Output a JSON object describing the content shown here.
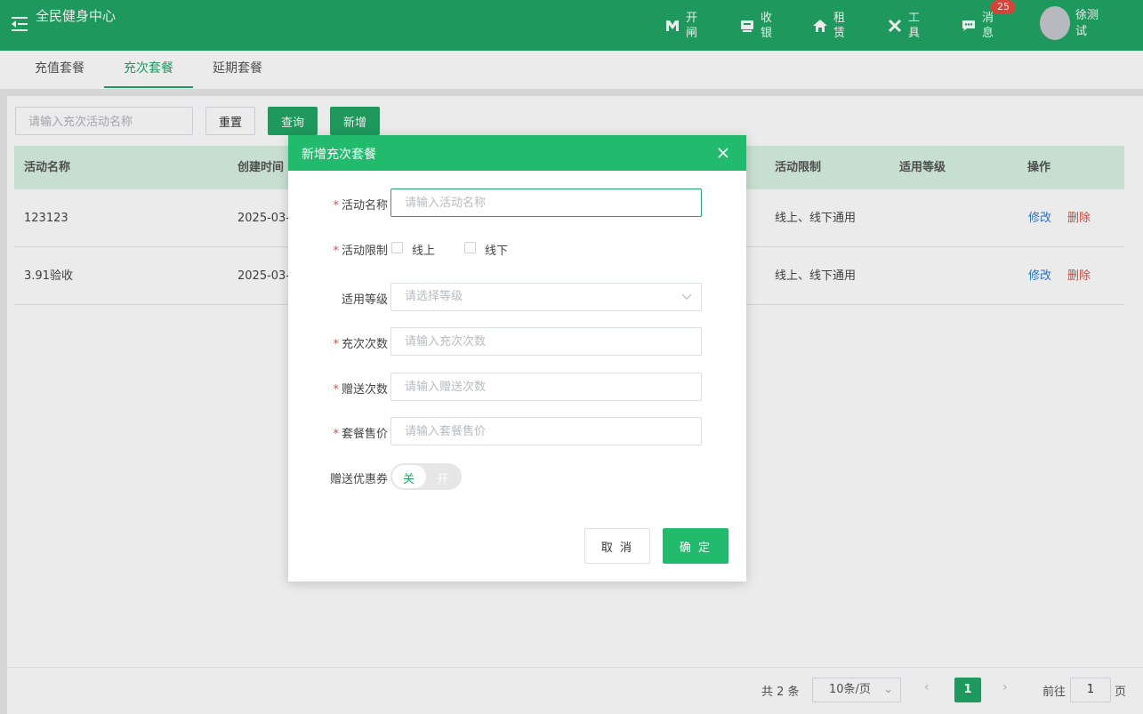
{
  "header": {
    "app_title": "全民健身中心",
    "nav": [
      {
        "label": "开闸",
        "icon": "gate-icon"
      },
      {
        "label": "收银",
        "icon": "cashier-icon"
      },
      {
        "label": "租赁",
        "icon": "home-icon"
      },
      {
        "label": "工具",
        "icon": "tools-icon"
      },
      {
        "label": "消息",
        "icon": "message-icon"
      }
    ],
    "message_badge": "25",
    "username": "徐测试"
  },
  "tabs": [
    "充值套餐",
    "充次套餐",
    "延期套餐"
  ],
  "active_tab": "充次套餐",
  "toolbar": {
    "search_placeholder": "请输入充次活动名称",
    "reset_label": "重置",
    "query_label": "查询",
    "add_label": "新增"
  },
  "table": {
    "columns": [
      "活动名称",
      "创建时间",
      "活动限制",
      "适用等级",
      "操作"
    ],
    "rows": [
      {
        "name": "123123",
        "created": "2025-03-",
        "limit": "线上、线下通用",
        "level": "",
        "edit": "修改",
        "delete": "删除"
      },
      {
        "name": "3.91验收",
        "created": "2025-03-",
        "limit": "线上、线下通用",
        "level": "",
        "edit": "修改",
        "delete": "删除"
      }
    ]
  },
  "pagination": {
    "total": "共 2 条",
    "page_size": "10条/页",
    "current": "1",
    "goto_label": "前往",
    "goto_value": "1",
    "goto_unit": "页"
  },
  "dialog": {
    "title": "新增充次套餐",
    "name_label": "活动名称",
    "name_placeholder": "请输入活动名称",
    "limit_label": "活动限制",
    "online_label": "线上",
    "offline_label": "线下",
    "level_label": "适用等级",
    "level_placeholder": "请选择等级",
    "count_label": "充次次数",
    "count_placeholder": "请输入充次次数",
    "gift_label": "赠送次数",
    "gift_placeholder": "请输入赠送次数",
    "price_label": "套餐售价",
    "price_placeholder": "请输入套餐售价",
    "coupon_label": "赠送优惠券",
    "switch_off": "关",
    "switch_on": "开",
    "cancel_label": "取 消",
    "ok_label": "确 定",
    "required_mark": "*"
  },
  "colors": {
    "brand": "#22a565",
    "dialog_header": "#22bb6e",
    "danger": "#e64a3e",
    "link": "#2d7bd4"
  }
}
